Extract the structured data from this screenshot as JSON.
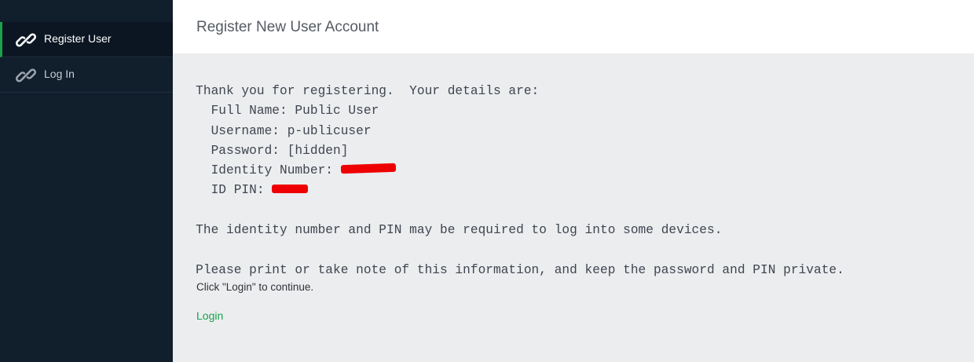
{
  "sidebar": {
    "items": [
      {
        "label": "Register User",
        "icon": "link-icon",
        "active": true
      },
      {
        "label": "Log In",
        "icon": "link-icon",
        "active": false
      }
    ]
  },
  "header": {
    "title": "Register New User Account"
  },
  "main": {
    "lines": {
      "thanks": "   Thank you for registering.  Your details are:",
      "full_name": "     Full Name: Public User",
      "username": "     Username: p-ublicuser",
      "password": "     Password: [hidden]",
      "identity_label": "     Identity Number: ",
      "pin_label": "     ID PIN: ",
      "identity_note": "   The identity number and PIN may be required to log into some devices.",
      "print_note": "   Please print or take note of this information, and keep the password and PIN private."
    },
    "continue_note": "Click \"Login\" to continue.",
    "login_link": "Login"
  },
  "colors": {
    "sidebar_bg": "#111e2c",
    "accent": "#1aa34a",
    "link": "#17a34a",
    "redaction": "#ee0000"
  }
}
